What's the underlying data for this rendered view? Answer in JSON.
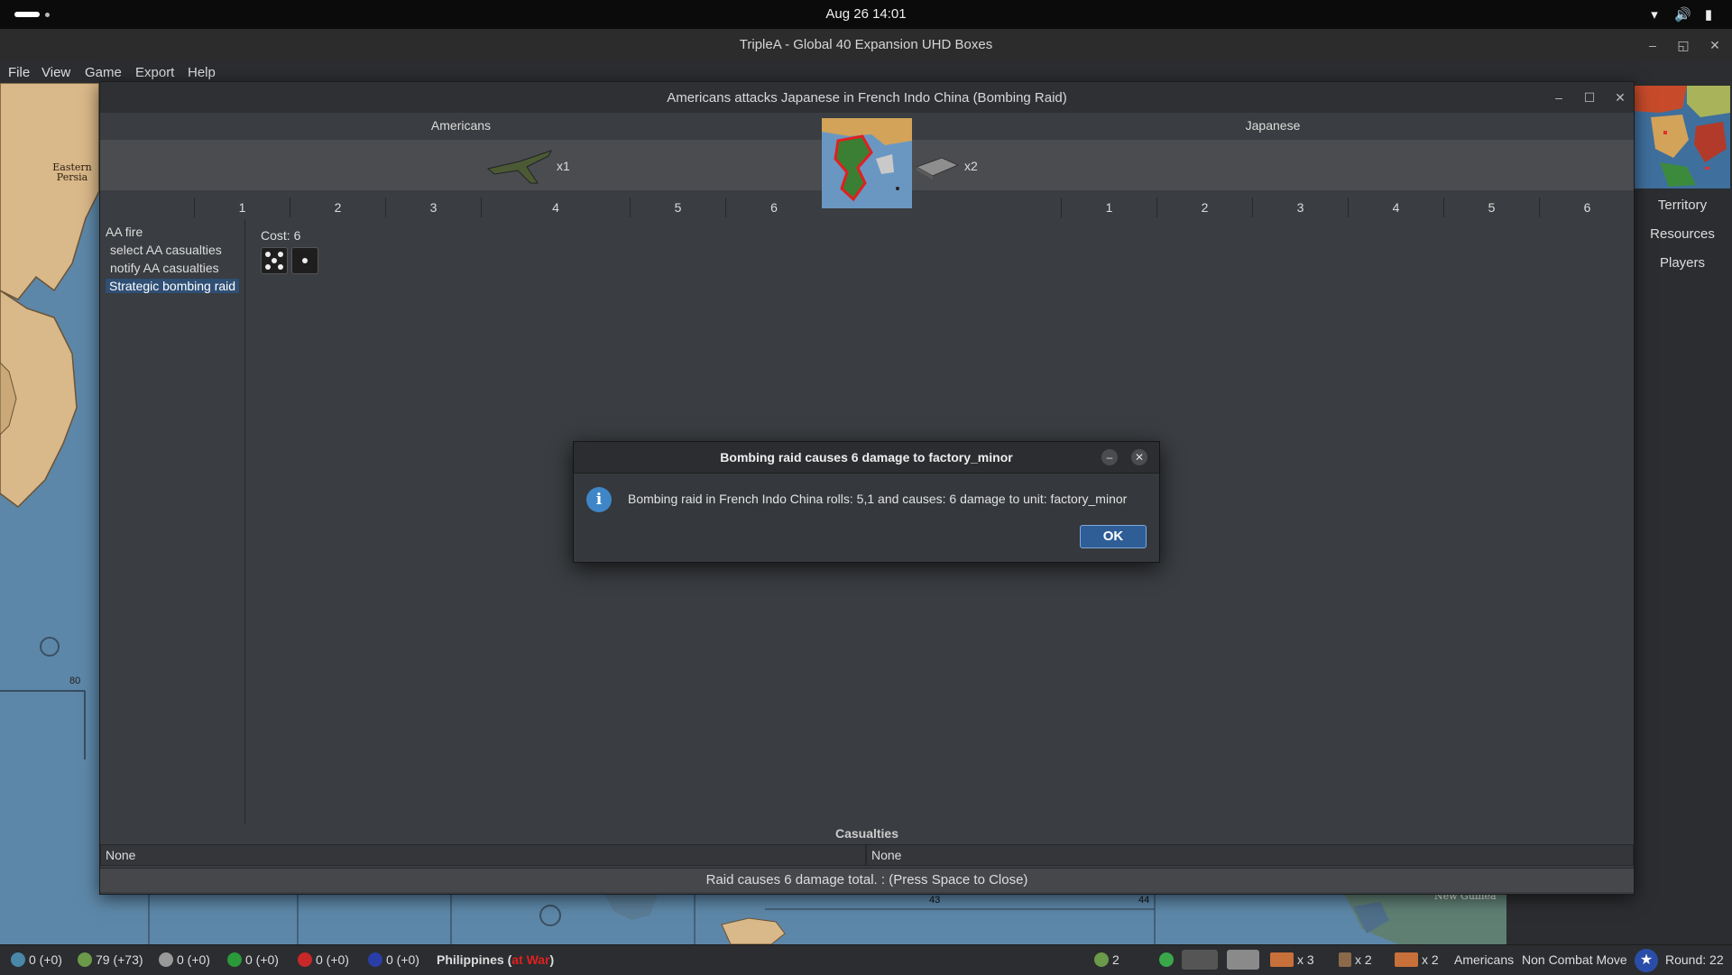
{
  "system_bar": {
    "clock": "Aug 26  14:01"
  },
  "window": {
    "title": "TripleA - Global 40 Expansion UHD Boxes"
  },
  "menu": [
    "File",
    "View",
    "Game",
    "Export",
    "Help"
  ],
  "battle": {
    "title": "Americans attacks Japanese in French Indo China  (Bombing Raid)",
    "attacker": {
      "name": "Americans",
      "unit_count": "x1"
    },
    "defender": {
      "name": "Japanese",
      "unit_count": "x2"
    },
    "dice_columns": [
      "1",
      "2",
      "3",
      "4",
      "5",
      "6"
    ],
    "steps": [
      "AA fire",
      "select AA casualties",
      "notify AA casualties",
      "Strategic bombing raid"
    ],
    "selected_step": "Strategic bombing raid",
    "cost_label": "Cost: 6",
    "dice_rolled": [
      5,
      1
    ],
    "casualties_header": "Casualties",
    "attacker_casualties": "None",
    "defender_casualties": "None",
    "status": "Raid causes 6 damage total. : (Press Space to Close)"
  },
  "message_dialog": {
    "title": "Bombing raid causes 6 damage to factory_minor",
    "text": "Bombing raid in French Indo China rolls: 5,1 and causes: 6 damage to unit: factory_minor",
    "ok_label": "OK"
  },
  "right_panel": {
    "tabs": [
      "Territory",
      "Resources",
      "Players"
    ]
  },
  "map_labels": {
    "territory": "Eastern Persia",
    "number_80": "80",
    "number_43": "43",
    "number_44": "44",
    "new_guinea": "New Guinea"
  },
  "status_bar": {
    "stats": [
      "0 (+0)",
      "79 (+73)",
      "0 (+0)",
      "0 (+0)",
      "0 (+0)",
      "0 (+0)"
    ],
    "territory": "Philippines",
    "territory_status": "at War",
    "resource_count": "2",
    "unit_counts": [
      "x 3",
      "x 2",
      "x 2"
    ],
    "player": "Americans",
    "phase": "Non Combat Move",
    "round": "Round: 22"
  },
  "colors": {
    "accent": "#2f5e96",
    "selection": "#2f4f75",
    "war": "#e02020",
    "sea": "#5d87a8",
    "land": "#d9b889"
  }
}
